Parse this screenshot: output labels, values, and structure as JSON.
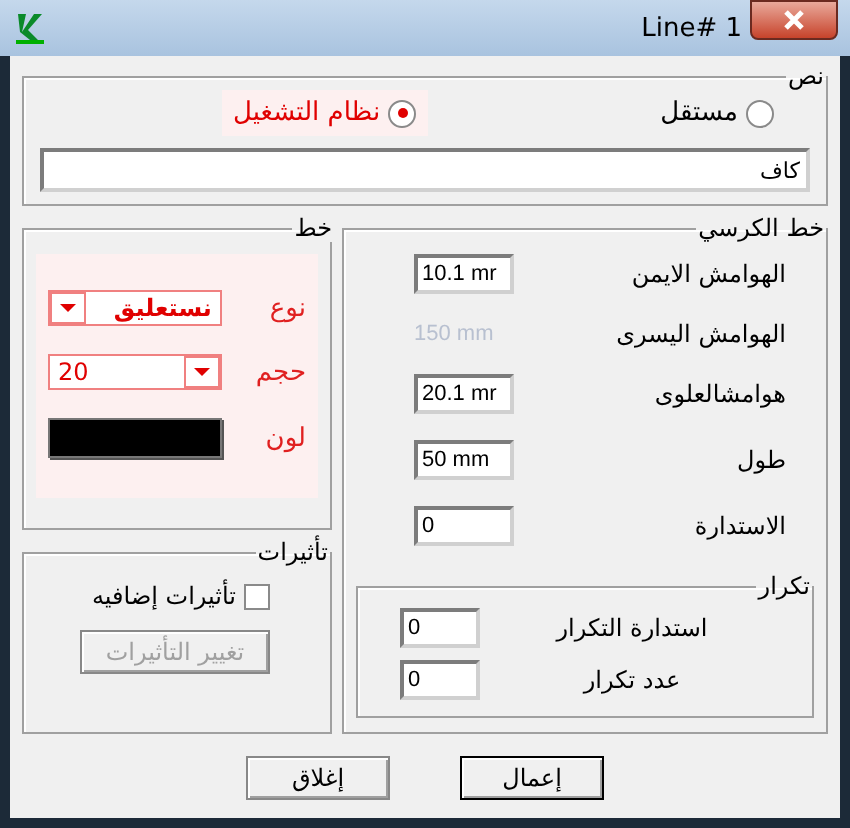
{
  "window": {
    "title": "Line# 1"
  },
  "text_group": {
    "title": "نص",
    "options": [
      {
        "label": "مستقل",
        "selected": false
      },
      {
        "label": "نظام التشغيل",
        "selected": true
      }
    ],
    "value": "كاف"
  },
  "font_group": {
    "title": "خط",
    "fields": [
      {
        "label": "نوع",
        "kind": "dropdown-rtl",
        "value": "نستعليق"
      },
      {
        "label": "حجم",
        "kind": "dropdown-ltr",
        "value": "20"
      },
      {
        "label": "لون",
        "kind": "color",
        "color": "#000000"
      }
    ]
  },
  "effects_group": {
    "title": "تأثيرات",
    "checkbox": {
      "label": "تأثيرات إضافيه",
      "checked": false
    },
    "button": {
      "label": "تغيير التأثيرات",
      "disabled": true
    }
  },
  "baseline_group": {
    "title": "خط الكرسي",
    "fields": [
      {
        "label": "الهوامش الايمن",
        "value": "10.1 mr",
        "disabled": false
      },
      {
        "label": "الهوامش اليسرى",
        "value": "150 mm",
        "disabled": true
      },
      {
        "label": "هوامشالعلوى",
        "value": "20.1 mr",
        "disabled": false
      },
      {
        "label": "طول",
        "value": "50 mm",
        "disabled": false
      },
      {
        "label": "الاستدارة",
        "value": "0",
        "disabled": false
      }
    ]
  },
  "repeat_group": {
    "title": "تكرار",
    "fields": [
      {
        "label": "استدارة التكرار",
        "value": "0"
      },
      {
        "label": "عدد تكرار",
        "value": "0"
      }
    ]
  },
  "buttons": [
    {
      "label": "إعمال",
      "default": true
    },
    {
      "label": "إغلاق",
      "default": false
    }
  ]
}
